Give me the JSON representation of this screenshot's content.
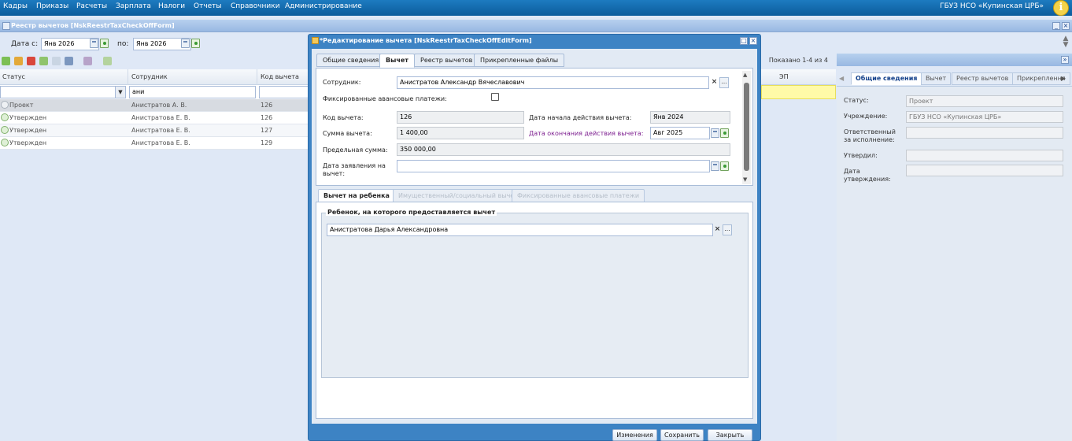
{
  "topbar": {
    "menu": [
      "Кадры",
      "Приказы",
      "Расчеты",
      "Зарплата",
      "Налоги",
      "Отчеты",
      "Справочники",
      "Администрирование"
    ],
    "org": "ГБУЗ НСО «Купинская ЦРБ»",
    "info_icon": "info-icon"
  },
  "main_panel": {
    "title": "Реестр вычетов [NskReestrTaxCheckOffForm]",
    "date_from_label": "Дата с:",
    "date_from": "Янв 2026",
    "date_to_label": "по:",
    "date_to": "Янв 2026",
    "shown": "Показано 1-4 из 4",
    "columns": [
      "Статус",
      "Сотрудник",
      "Код вычета",
      "ЭП"
    ],
    "filter_employee": "ани",
    "rows": [
      {
        "status": "Проект",
        "employee": "Анистратов А. В.",
        "code": "126"
      },
      {
        "status": "Утвержден",
        "employee": "Анистратова Е. В.",
        "code": "126"
      },
      {
        "status": "Утвержден",
        "employee": "Анистратова Е. В.",
        "code": "127"
      },
      {
        "status": "Утвержден",
        "employee": "Анистратова Е. В.",
        "code": "129"
      }
    ]
  },
  "right_panel": {
    "tabs": [
      "Общие сведения",
      "Вычет",
      "Реестр вычетов",
      "Прикреплення"
    ],
    "fields": [
      {
        "label": "Статус:",
        "value": "Проект"
      },
      {
        "label": "Учреждение:",
        "value": "ГБУЗ НСО «Купинская ЦРБ»"
      },
      {
        "label": "Ответственный за исполнение:",
        "value": ""
      },
      {
        "label": "Утвердил:",
        "value": ""
      },
      {
        "label": "Дата утверждения:",
        "value": ""
      }
    ]
  },
  "dialog": {
    "title": "*Редактирование вычета [NskReestrTaxCheckOffEditForm]",
    "tabs": [
      "Общие сведения",
      "Вычет",
      "Реестр вычетов",
      "Прикрепленные файлы"
    ],
    "employee_label": "Сотрудник:",
    "employee": "Анистратов Александр Вячеславович",
    "fixed_advance_label": "Фиксированные авансовые платежи:",
    "code_label": "Код вычета:",
    "code": "126",
    "start_label": "Дата начала действия вычета:",
    "start": "Янв 2024",
    "sum_label": "Сумма вычета:",
    "sum": "1 400,00",
    "end_label": "Дата окончания действия вычета:",
    "end": "Авг 2025",
    "limit_label": "Предельная сумма:",
    "limit": "350 000,00",
    "application_label": "Дата заявления на вычет:",
    "application": "",
    "bottom_tabs": [
      "Вычет на ребенка",
      "Имущественный/социальный вычет",
      "Фиксированные авансовые платежи"
    ],
    "child_legend": "Ребенок, на которого предоставляется вычет",
    "child": "Анистратова Дарья Александровна",
    "buttons": {
      "changes": "Изменения",
      "save": "Сохранить",
      "close": "Закрыть"
    }
  }
}
